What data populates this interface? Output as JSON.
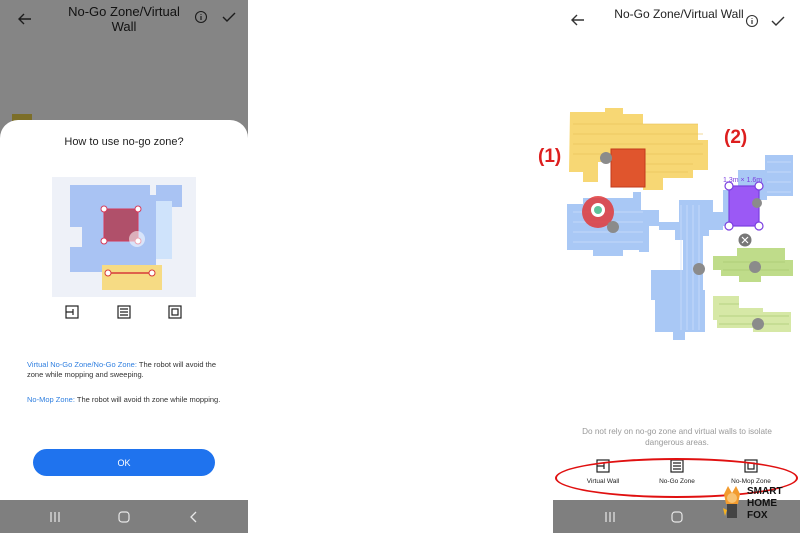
{
  "left_screen": {
    "header": {
      "title": "No-Go Zone/Virtual Wall",
      "back_icon": "arrow-left-icon",
      "info_icon": "info-icon",
      "confirm_icon": "check-icon"
    },
    "dialog": {
      "title": "How to use no-go zone?",
      "tool_icons": [
        "virtual-wall-icon",
        "no-go-zone-icon",
        "no-mop-zone-icon"
      ],
      "virtual_no_go_term": "Virtual No-Go Zone/No-Go Zone:",
      "virtual_no_go_text": " The robot will avoid the zone while mopping and sweeping.",
      "no_mop_term": "No-Mop Zone:",
      "no_mop_text": " The robot will avoid th zone while mopping.",
      "ok_label": "OK"
    },
    "nav": {
      "recents_icon": "recents-icon",
      "home_icon": "home-icon",
      "back_icon": "chevron-left-icon"
    }
  },
  "right_screen": {
    "header": {
      "title": "No-Go Zone/Virtual Wall",
      "back_icon": "arrow-left-icon",
      "info_icon": "info-icon",
      "confirm_icon": "check-icon"
    },
    "map": {
      "zone_dimension_label": "1.3m × 1.6m"
    },
    "warning": "Do not rely on no-go zone and virtual walls to isolate dangerous areas.",
    "tools": [
      {
        "label": "Virtual Wall",
        "icon": "virtual-wall-icon"
      },
      {
        "label": "No-Go Zone",
        "icon": "no-go-zone-icon"
      },
      {
        "label": "No-Mop Zone",
        "icon": "no-mop-zone-icon"
      }
    ],
    "nav": {
      "recents_icon": "recents-icon",
      "home_icon": "home-icon"
    }
  },
  "annotations": {
    "label_1": "(1)",
    "label_2": "(2)"
  },
  "watermark": {
    "line1": "SMART",
    "line2": "HOME",
    "line3": "FOX"
  },
  "colors": {
    "accent_blue": "#1f73ee",
    "annotation_red": "#dd1e1e",
    "no_go_zone_purple": "#9b59f5",
    "no_go_zone_red": "#e0552d",
    "room_yellow": "#f7d774",
    "room_blue": "#a9c8f5",
    "room_green": "#bfdc8a"
  }
}
